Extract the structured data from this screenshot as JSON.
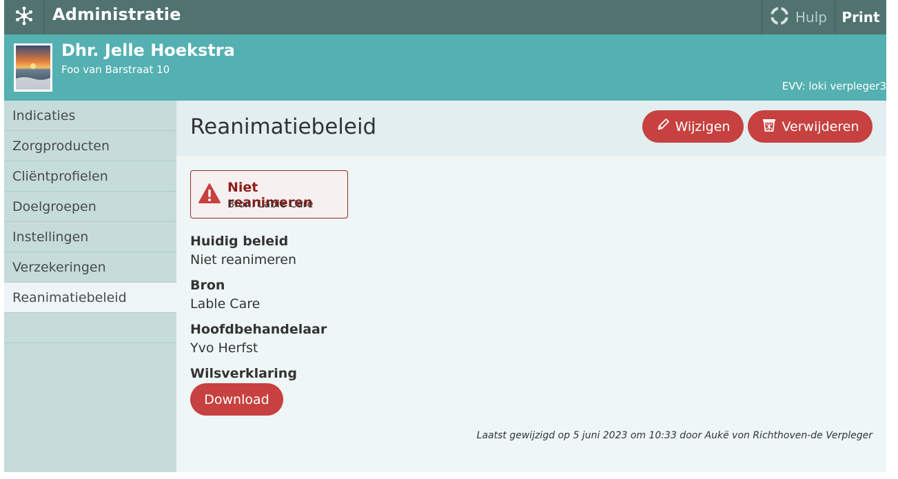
{
  "topbar": {
    "logo_icon": "snowflake-logo-icon",
    "title": "Administratie",
    "help_label": "Hulp",
    "help_icon": "lifebuoy-icon",
    "print_label": "Print"
  },
  "client": {
    "name": "Dhr. Jelle Hoekstra",
    "address": "Foo van Barstraat 10",
    "evv": "EVV: loki verpleger3"
  },
  "sidebar": {
    "items": [
      {
        "label": "Indicaties"
      },
      {
        "label": "Zorgproducten"
      },
      {
        "label": "Cliëntprofielen"
      },
      {
        "label": "Doelgroepen"
      },
      {
        "label": "Instellingen"
      },
      {
        "label": "Verzekeringen"
      },
      {
        "label": "Reanimatiebeleid",
        "active": true
      }
    ]
  },
  "main": {
    "title": "Reanimatiebeleid",
    "edit_label": "Wijzigen",
    "delete_label": "Verwijderen",
    "alert": {
      "title": "Niet reanimeren",
      "source": "Bron: Lable Care"
    },
    "fields": [
      {
        "label": "Huidig beleid",
        "value": "Niet reanimeren"
      },
      {
        "label": "Bron",
        "value": "Lable Care"
      },
      {
        "label": "Hoofdbehandelaar",
        "value": "Yvo Herfst"
      },
      {
        "label": "Wilsverklaring"
      }
    ],
    "download_label": "Download",
    "footnote": "Laatst gewijzigd op 5 juni 2023 om 10:33 door Aukë von Richthoven-de Verpleger"
  },
  "colors": {
    "topbar": "#517370",
    "client_header": "#54b0b1",
    "sidebar": "#c5dcdb",
    "accent_red": "#c6413f",
    "alert_red": "#8f1b1b"
  }
}
